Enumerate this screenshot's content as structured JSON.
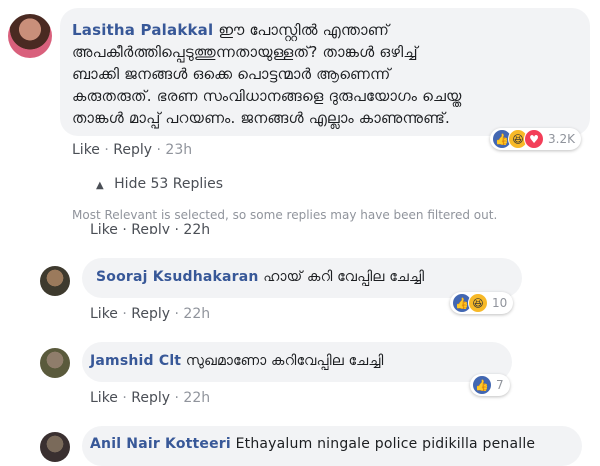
{
  "comment": {
    "author": "Lasitha Palakkal",
    "lines": [
      "ഈ പോസ്റ്റിൽ എന്താണ്",
      "അപകീർത്തിപ്പെടുത്തുന്നതായുള്ളത്? താങ്കൾ ഒഴിച്ച്",
      "ബാക്കി ജനങ്ങൾ ഒക്കെ പൊട്ടന്മാർ ആണെന്ന്",
      "കരുതരുത്. ഭരണ സംവിധാനങ്ങളെ ദുരുപയോഗം ചെയ്ത",
      "താങ്കൾ മാപ്പ് പറയണം. ജനങ്ങൾ എല്ലാം കാണുന്നുണ്ട്."
    ],
    "like": "Like",
    "reply": "Reply",
    "time": "23h",
    "reaction_count": "3.2K"
  },
  "hide_replies": "Hide 53 Replies",
  "filter_note": "Most Relevant is selected, so some replies may have been filtered out.",
  "cut_row": {
    "like": "Like",
    "reply": "Reply",
    "time": "22h"
  },
  "replies": [
    {
      "author": "Sooraj Ksudhakaran",
      "text": "ഹായ് കറി വേപ്പില ചേച്ചി",
      "like": "Like",
      "reply": "Reply",
      "time": "22h",
      "reaction_count": "10"
    },
    {
      "author": "Jamshid Clt",
      "text": "സുഖമാണോ കറിവേപ്പില ചേച്ചി",
      "like": "Like",
      "reply": "Reply",
      "time": "22h",
      "reaction_count": "7"
    },
    {
      "author": "Anil Nair Kotteeri",
      "text": "Ethayalum ningale police pidikilla penalle"
    }
  ],
  "icons": [
    "like-icon",
    "haha-icon",
    "love-icon",
    "chevron-up-icon"
  ],
  "colors": {
    "author": "#385898",
    "bubble": "#f2f3f5",
    "like": "#4267b2",
    "haha": "#f7b928",
    "love": "#f33e58",
    "meta": "#90949c"
  }
}
